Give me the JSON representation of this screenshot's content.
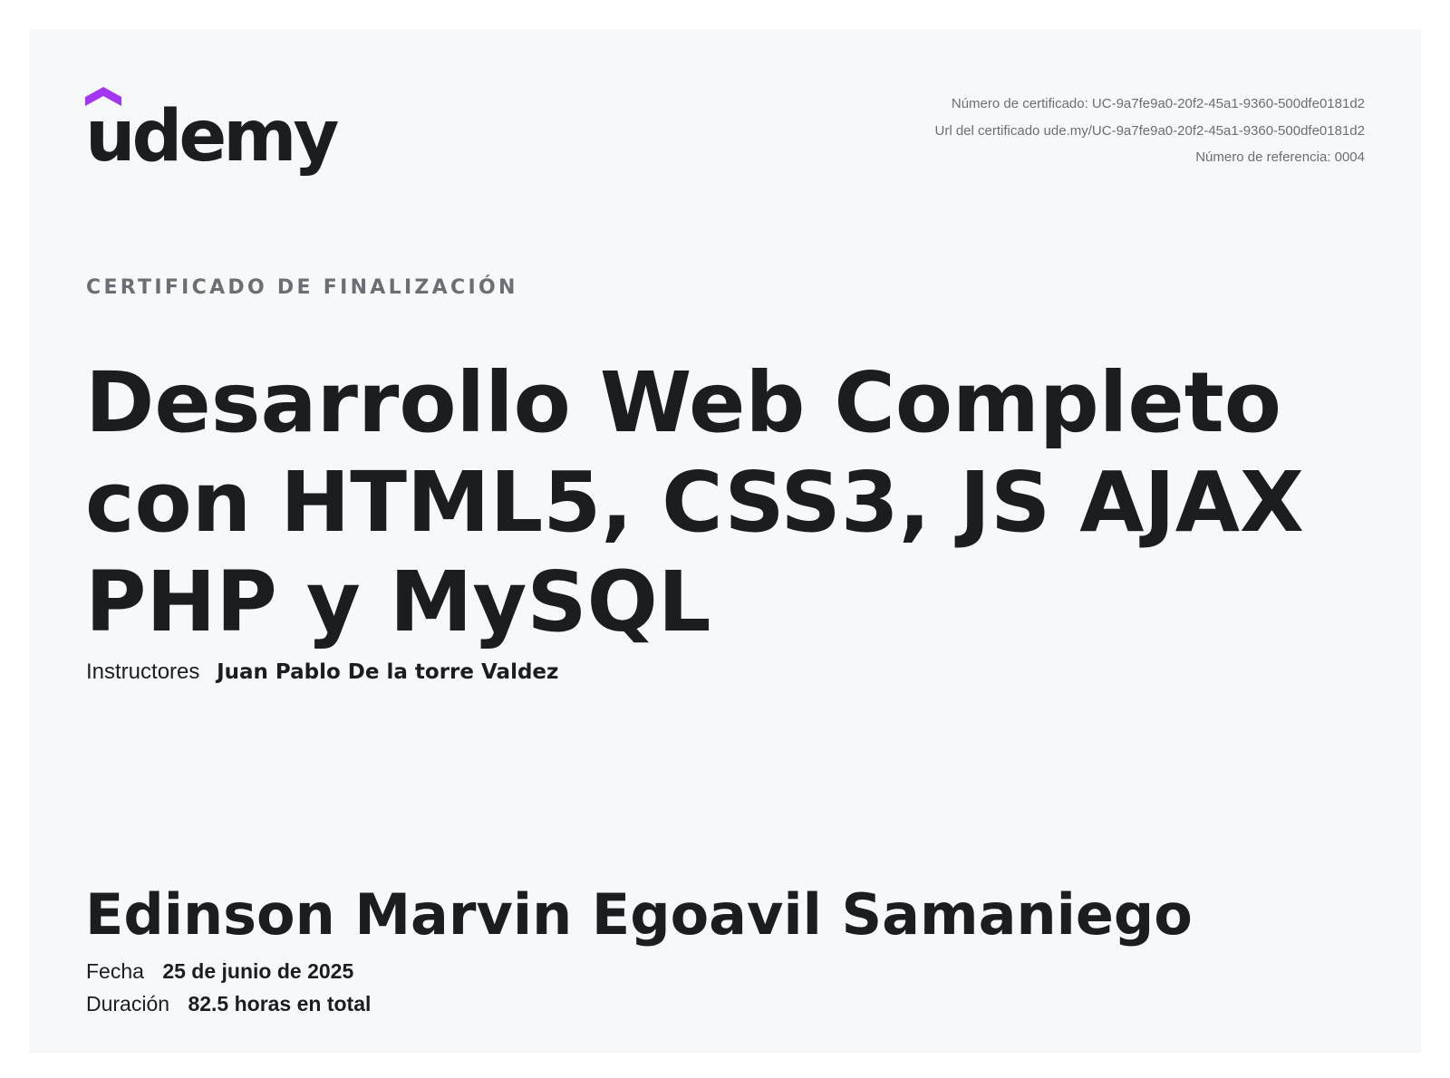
{
  "brand": {
    "logo_text": "udemy",
    "accent_color": "#a435f0",
    "text_color": "#1c1d1f"
  },
  "meta": {
    "certificate_number": "Número de certificado: UC-9a7fe9a0-20f2-45a1-9360-500dfe0181d2",
    "certificate_url": "Url del certificado ude.my/UC-9a7fe9a0-20f2-45a1-9360-500dfe0181d2",
    "reference_number": "Número de referencia: 0004"
  },
  "certificate": {
    "eyebrow": "CERTIFICADO DE FINALIZACIÓN",
    "course_title": "Desarrollo Web Completo con HTML5, CSS3, JS AJAX PHP y MySQL",
    "instructors_label": "Instructores",
    "instructors_value": "Juan Pablo De la torre Valdez",
    "student_name": "Edinson Marvin Egoavil Samaniego",
    "date_label": "Fecha",
    "date_value": "25 de junio de 2025",
    "duration_label": "Duración",
    "duration_value": "82.5 horas en total"
  }
}
